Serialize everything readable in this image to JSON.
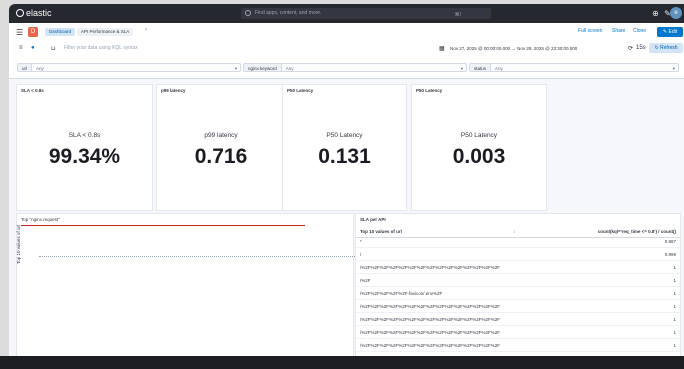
{
  "topbar": {
    "brand": "elastic",
    "search_placeholder": "Find apps, content, and more.",
    "search_shortcut": "⌘/"
  },
  "nav": {
    "space_initial": "D",
    "breadcrumbs": [
      "Dashboard",
      "API Performance & SLA"
    ],
    "links": [
      "Full screen",
      "Share",
      "Clone"
    ],
    "edit_label": "Edit"
  },
  "query": {
    "placeholder": "Filter your data using KQL syntax",
    "date_range": "Nov 27, 2025 @ 00:00:00.000 → Nov 28, 2025 @ 23:30:00.000",
    "interval": "15s",
    "refresh_label": "Refresh"
  },
  "controls": [
    {
      "label": "url",
      "value": "Any"
    },
    {
      "label": "nginx.keyword",
      "value": "Any"
    },
    {
      "label": "status",
      "value": "Any"
    }
  ],
  "metrics": [
    {
      "title": "SLA < 0.8s",
      "label": "SLA < 0.8s",
      "value": "99.34%"
    },
    {
      "title": "p99 latency",
      "label": "p99 latency",
      "value": "0.716"
    },
    {
      "title": "P50 Latency",
      "label": "P50 Latency",
      "value": "0.131"
    },
    {
      "title": "P50 Latency",
      "label": "P50 Latency",
      "value": "0.003"
    }
  ],
  "left_panel": {
    "title": "Top \"nginx.request\"",
    "y_axis_label": "Top 10 values of url"
  },
  "table_panel": {
    "title": "SLA per API",
    "col1": "Top 10 values of url",
    "col2": "count(kql='req_time <= 0.8') / count()",
    "rows": [
      {
        "url": "*",
        "value": "0.987"
      },
      {
        "url": "/",
        "value": "0.999"
      },
      {
        "url": "/%2F%2F%2F%2F%2F%2F%2F%2F%2F%2F%2F%2F%2F%2F%2F",
        "value": "1"
      },
      {
        "url": "/%2F",
        "value": "1"
      },
      {
        "url": "/%2F%2F%2F%2F%2F-favicon/.env%2F",
        "value": "1"
      },
      {
        "url": "/%2F%2F%2F%2F%2F%2F%2F%2F%2F%2F%2F%2F%2F%2F%2F",
        "value": "1"
      },
      {
        "url": "/%2F%2F%2F%2F%2F%2F%2F%2F%2F%2F%2F%2F%2F%2F%2F",
        "value": "1"
      },
      {
        "url": "/%2F%2F%2F%2F%2F%2F%2F%2F%2F%2F%2F%2F%2F%2F%2F",
        "value": "1"
      },
      {
        "url": "/%2F%2F%2F%2F%2F%2F%2F%2F%2F%2F%2F%2F%2F%2F%2F",
        "value": "1"
      }
    ]
  },
  "colors": {
    "topbar": "#25282f",
    "accent": "#0077cc",
    "space_badge": "#e7664c",
    "alert_line": "#bd271e"
  }
}
